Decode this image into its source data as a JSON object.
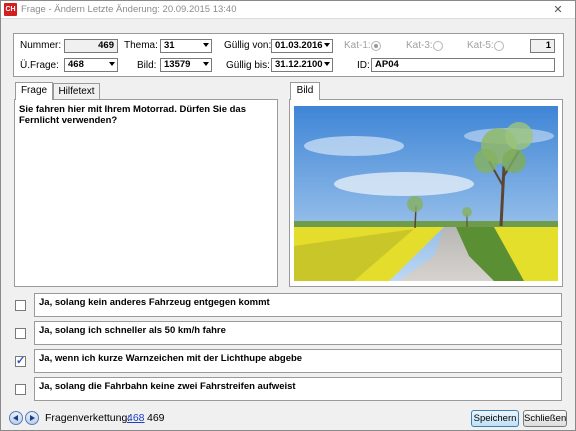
{
  "window": {
    "app_icon_text": "CH",
    "title": "Frage - Ändern   Letzte Änderung: 20.09.2015 13:40",
    "close_symbol": "✕"
  },
  "header": {
    "nummer_label": "Nummer:",
    "nummer_value": "469",
    "thema_label": "Thema:",
    "thema_value": "31",
    "gueltig_von_label": "Güllig von:",
    "gueltig_von_value": "01.03.2016",
    "kat1_label": "Kat-1:",
    "kat3_label": "Kat-3:",
    "kat5_label": "Kat-5:",
    "kat_count": "1",
    "ufrage_label": "Ü.Frage:",
    "ufrage_value": "468",
    "bild_label": "Bild:",
    "bild_value": "13579",
    "gueltig_bis_label": "Güllig bis:",
    "gueltig_bis_value": "31.12.2100",
    "id_label": "ID:",
    "id_value": "AP04"
  },
  "tabs": {
    "frage": "Frage",
    "hilfetext": "Hilfetext",
    "bild": "Bild"
  },
  "question": {
    "text": "Sie fahren hier mit Ihrem Motorrad. Dürfen Sie das Fernlicht verwenden?"
  },
  "answers": [
    {
      "text": "Ja, solang kein anderes Fahrzeug entgegen kommt",
      "checked": false
    },
    {
      "text": "Ja, solang ich schneller als 50 km/h fahre",
      "checked": false
    },
    {
      "text": "Ja, wenn ich kurze Warnzeichen mit der Lichthupe abgebe",
      "checked": true
    },
    {
      "text": "Ja, solang die Fahrbahn keine zwei Fahrstreifen aufweist",
      "checked": false
    }
  ],
  "footer": {
    "verkettung_label": "Fragenverkettung:",
    "verkettung_link": "468",
    "verkettung_current": "469",
    "save_label": "Speichern",
    "close_label": "Schließen"
  },
  "colors": {
    "accent": "#3c7fb1",
    "link": "#1a3fc4",
    "app_icon": "#d21f1f"
  }
}
